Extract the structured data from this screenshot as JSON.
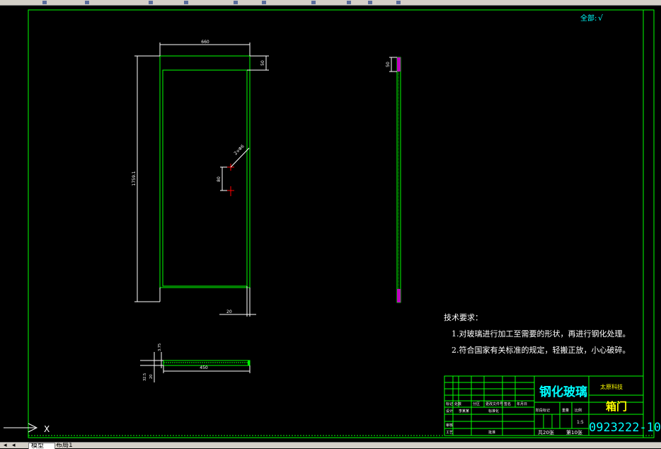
{
  "colors": {
    "background": "#000000",
    "border": "#00ff00",
    "dim": "#ffffff",
    "text": "#ffffff",
    "cyan": "#00ffff",
    "yellow": "#ffff00",
    "magenta": "#c000c0",
    "red": "#ff0000",
    "green": "#00ff00"
  },
  "toolbar": {
    "icons": [
      "new-icon",
      "open-icon",
      "save-icon",
      "print-icon",
      "cut-icon",
      "copy-icon",
      "paste-icon",
      "undo-icon",
      "redo-icon",
      "zoom-icon"
    ]
  },
  "roughness": {
    "label": "全部:",
    "symbol": "√"
  },
  "front_view": {
    "width_dim": "660",
    "top_dim": "50",
    "height_dim": "1759.1",
    "hole_dim": "2×Φ6",
    "hole_offset_dim": "80",
    "bottom_dim": "20"
  },
  "side_view": {
    "dim": "50"
  },
  "section_view": {
    "dim_1": "3.75",
    "dim_2": "20",
    "dim_3": "32.5",
    "length_dim": "450"
  },
  "notes": {
    "title": "技术要求：",
    "items": [
      "1.对玻璃进行加工至需要的形状，再进行钢化处理。",
      "2.符合国家有关标准的规定，轻搬正放，小心破碎。"
    ]
  },
  "title_block": {
    "part_name": "钢化玻璃",
    "school": "太原科技",
    "assembly": "箱门",
    "drawing_no": "0923222-10",
    "scale": "1:5",
    "material_cols": [
      "阶段标记",
      "重量",
      "比例"
    ],
    "sheet_total": "共20张",
    "sheet_no": "第10张",
    "grid": {
      "r1": [
        "标记",
        "处数",
        "分区",
        "更改文件号",
        "签名",
        "年月日"
      ],
      "r2": [
        "设计",
        "李某某",
        "标准化"
      ],
      "r3": [
        "审核"
      ],
      "r4": [
        "工艺",
        "批准"
      ]
    }
  },
  "ucs": {
    "label": "X"
  },
  "tabs": [
    "模型",
    "布局1"
  ]
}
